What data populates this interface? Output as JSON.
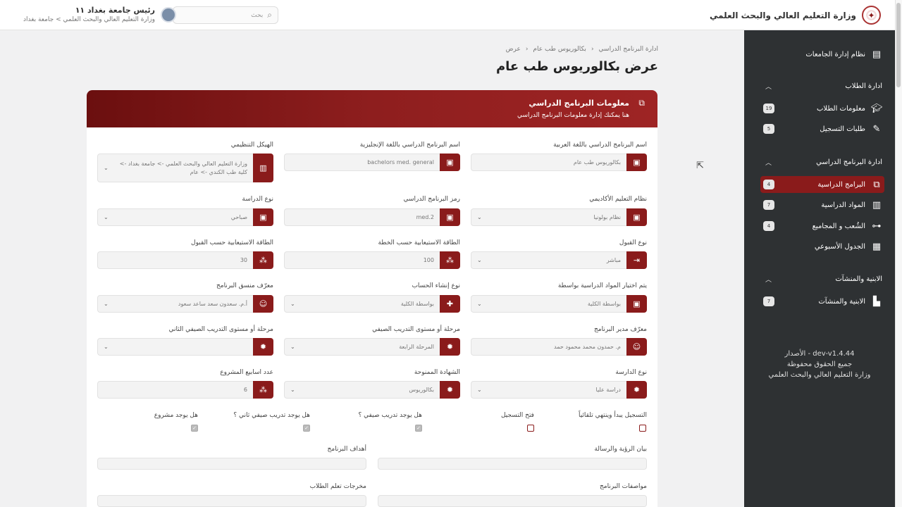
{
  "header": {
    "brand_name": "وزارة التعليم العالي والبحث العلمي",
    "user_name": "رئيس جامعة بغداد ١١",
    "user_sub": "وزارة التعليم العالي والبحث العلمي > جامعة بغداد",
    "search_placeholder": "بحث"
  },
  "sidebar": {
    "top_item": "نظام إدارة الجامعات",
    "sections": [
      {
        "title": "ادارة الطلاب",
        "items": [
          {
            "label": "معلومات الطلاب",
            "count": "19"
          },
          {
            "label": "طلبات التسجيل",
            "count": "5"
          }
        ]
      },
      {
        "title": "ادارة البرنامج الدراسي",
        "items": [
          {
            "label": "البرامج الدراسية",
            "count": "4"
          },
          {
            "label": "المواد الدراسية",
            "count": "7"
          },
          {
            "label": "الشُعب و المجاميع",
            "count": "4"
          },
          {
            "label": "الجدول الأسبوعي",
            "count": ""
          }
        ]
      },
      {
        "title": "الابنية والمنشآت",
        "items": [
          {
            "label": "الابنية والمنشآت",
            "count": "7"
          }
        ]
      }
    ],
    "footer": [
      "الأصدار - dev-v1.4.44",
      "جميع الحقوق محفوظة",
      "وزارة التعليم العالي والبحث العلمي"
    ]
  },
  "breadcrumb": [
    "ادارة البرنامج الدراسي",
    "بكالوريوس طب عام",
    "عرض"
  ],
  "page_title": "عرض بكالوريوس طب عام",
  "card": {
    "title": "معلومات البرنامج الدراسي",
    "subtitle": "هنا يمكنك إدارة معلومات البرنامج الدراسي"
  },
  "fields": {
    "name_ar": {
      "label": "اسم البرنامج الدراسي باللغة العربية",
      "value": "بكالوريوس طب عام"
    },
    "name_en": {
      "label": "اسم البرنامج الدراسي باللغة الإنجليزية",
      "value": "bachelors med. general"
    },
    "org": {
      "label": "الهيكل التنظيمي",
      "value": "وزارة التعليم العالي والبحث العلمي -> جامعة بغداد -> كلية طب الكندي -> عام"
    },
    "academic_system": {
      "label": "نظام التعليم الأكاديمي",
      "value": "نظام بولونيا"
    },
    "program_code": {
      "label": "رمز البرنامج الدراسي",
      "value": "med.2"
    },
    "study_type": {
      "label": "نوع الدراسة",
      "value": "صباحي"
    },
    "admission_type": {
      "label": "نوع القبول",
      "value": "مباشر"
    },
    "capacity_plan": {
      "label": "الطاقة الاستيعابية حسب الخطة",
      "value": "100"
    },
    "capacity_admission": {
      "label": "الطاقة الاستيعابية حسب القبول",
      "value": "30"
    },
    "subject_select": {
      "label": "يتم اختيار المواد الدراسية بواسطة",
      "value": "بواسطة الكلية"
    },
    "account_creation": {
      "label": "نوع إنشاء الحساب",
      "value": "بواسطة الكلية"
    },
    "coordinator": {
      "label": "معرّف منسق البرنامج",
      "value": "أ.م. سعدون سعد ساعد سعود"
    },
    "director": {
      "label": "معرّف مدير البرنامج",
      "value": "م. حمدون محمد محمود حمد"
    },
    "training_stage": {
      "label": "مرحلة أو مستوى التدريب الصيفي",
      "value": "المرحلة الرابعة"
    },
    "training_stage2": {
      "label": "مرحلة أو مستوى التدريب الصيفي الثاني",
      "value": ""
    },
    "study_kind": {
      "label": "نوع الدارسة",
      "value": "دراسة عليا"
    },
    "certificate": {
      "label": "الشهادة الممنوحة",
      "value": "بكالوريوس"
    },
    "project_weeks": {
      "label": "عدد اسابيع المشروع",
      "value": "6"
    }
  },
  "checkboxes": [
    {
      "label": "التسجيل يبدأ وينتهي تلقائياً",
      "checked": false
    },
    {
      "label": "فتح التسجيل",
      "checked": false
    },
    {
      "label": "هل يوجد تدريب صيفي ؟",
      "checked": true
    },
    {
      "label": "هل يوجد تدريب صيفي ثاني ؟",
      "checked": true
    },
    {
      "label": "هل يوجد مشروع",
      "checked": true
    }
  ],
  "text_areas": {
    "vision": "بيان الرؤية والرسالة",
    "goals": "أهداف البرنامج",
    "specs": "مواصفات البرنامج",
    "outcomes": "مخرجات تعلم الطلاب"
  },
  "colors": {
    "accent": "#8a1b1b",
    "sidebar_bg": "#2e3133"
  }
}
